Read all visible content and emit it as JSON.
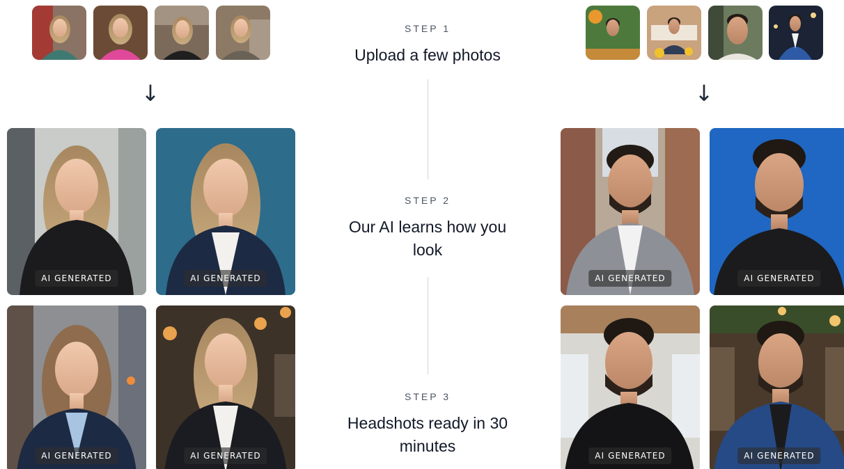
{
  "steps": [
    {
      "label": "STEP 1",
      "title": "Upload a few photos"
    },
    {
      "label": "STEP 2",
      "title": "Our AI learns how you look"
    },
    {
      "label": "STEP 3",
      "title": "Headshots ready in 30 minutes"
    }
  ],
  "badge_text": "AI GENERATED",
  "arrow_glyph": "↓",
  "colors": {
    "text": "#111827",
    "muted": "#4b5563",
    "divider": "#d1d5db",
    "badge_bg": "#2d2d2d"
  }
}
